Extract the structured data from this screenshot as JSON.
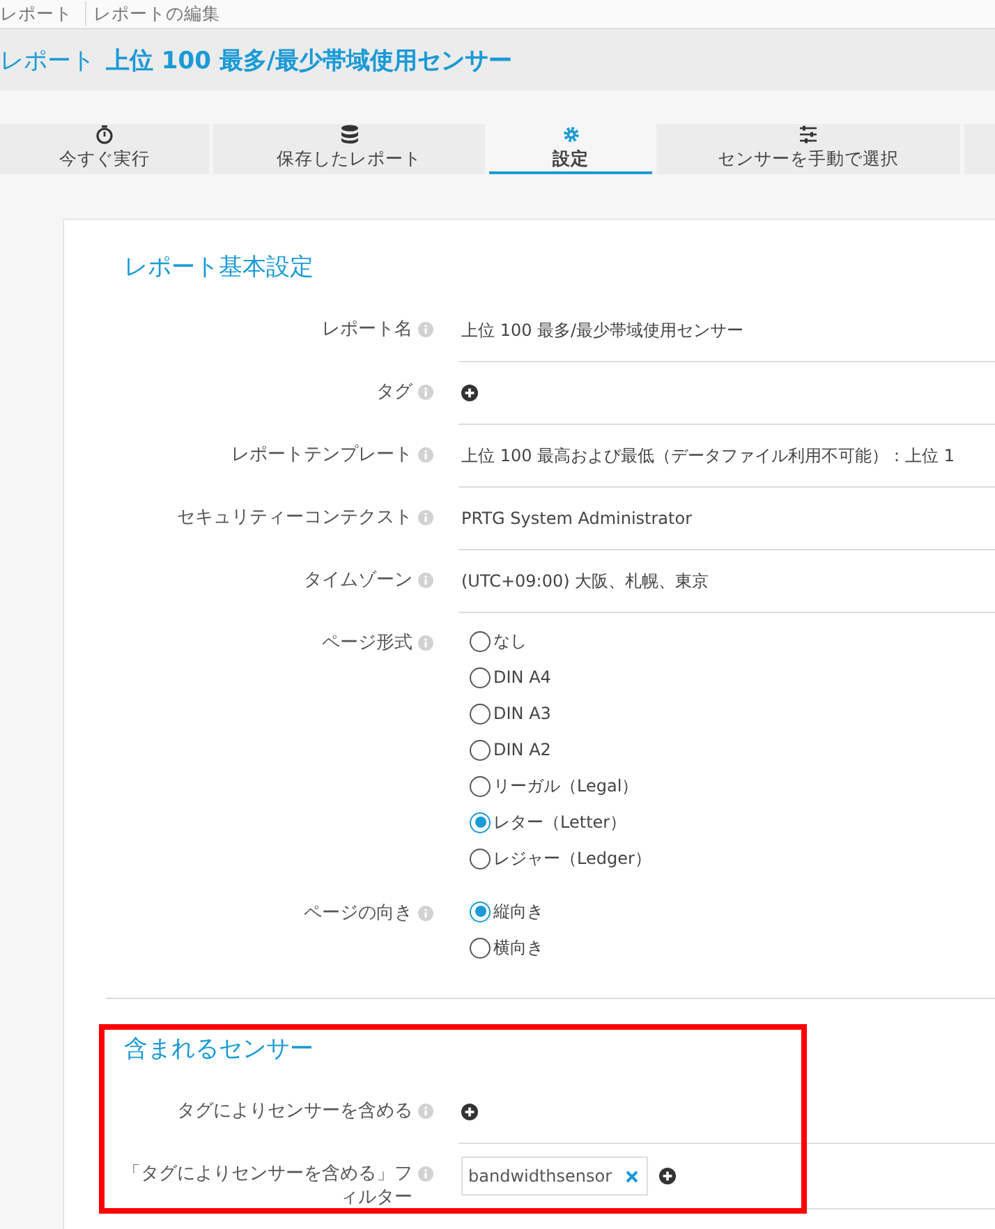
{
  "breadcrumbs": [
    {
      "label": "レポート"
    },
    {
      "label": "レポートの編集"
    }
  ],
  "header": {
    "prefix": "レポート",
    "title": "上位 100 最多/最少帯域使用センサー"
  },
  "tabs": [
    {
      "label": "今すぐ実行",
      "selected": false
    },
    {
      "label": "保存したレポート",
      "selected": false
    },
    {
      "label": "設定",
      "selected": true
    },
    {
      "label": "センサーを手動で選択",
      "selected": false
    }
  ],
  "sections": [
    {
      "title": "レポート基本設定",
      "fields": [
        {
          "label": "レポート名",
          "kind": "text",
          "value": "上位 100 最多/最少帯域使用センサー"
        },
        {
          "label": "タグ",
          "kind": "tags"
        },
        {
          "label": "レポートテンプレート",
          "kind": "text",
          "value": "上位 100 最高および最低（データファイル利用不可能）：上位 1"
        },
        {
          "label": "セキュリティーコンテクスト",
          "kind": "text",
          "value": "PRTG System Administrator"
        },
        {
          "label": "タイムゾーン",
          "kind": "text",
          "value": "(UTC+09:00) 大阪、札幌、東京"
        },
        {
          "label": "ページ形式",
          "kind": "radio",
          "options": [
            {
              "label": "なし",
              "selected": false
            },
            {
              "label": "DIN A4",
              "selected": false
            },
            {
              "label": "DIN A3",
              "selected": false
            },
            {
              "label": "DIN A2",
              "selected": false
            },
            {
              "label": "リーガル（Legal）",
              "selected": false
            },
            {
              "label": "レター（Letter）",
              "selected": true
            },
            {
              "label": "レジャー（Ledger）",
              "selected": false
            }
          ]
        },
        {
          "label": "ページの向き",
          "kind": "radio",
          "options": [
            {
              "label": "縦向き",
              "selected": true
            },
            {
              "label": "横向き",
              "selected": false
            }
          ]
        }
      ]
    },
    {
      "title": "含まれるセンサー",
      "highlighted": true,
      "fields": [
        {
          "label": "タグによりセンサーを含める",
          "kind": "tags"
        },
        {
          "label": "「タグによりセンサーを含める」フィルター",
          "kind": "tags",
          "tags": [
            "bandwidthsensor"
          ]
        }
      ]
    }
  ]
}
